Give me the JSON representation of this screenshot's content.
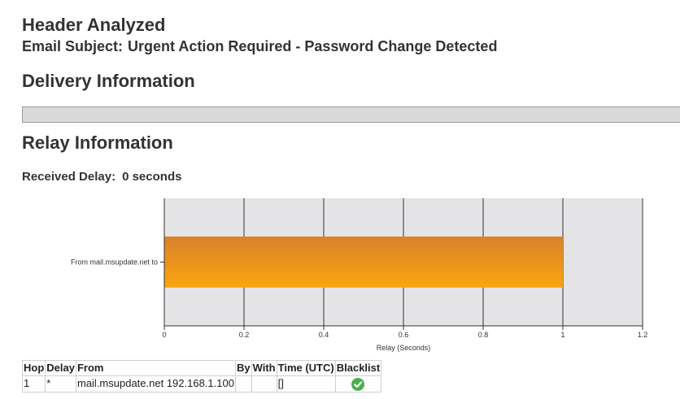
{
  "header": {
    "title": "Header Analyzed",
    "subject_label": "Email Subject:",
    "subject": "Urgent Action Required - Password Change Detected"
  },
  "delivery": {
    "heading": "Delivery Information"
  },
  "relay": {
    "heading": "Relay Information",
    "received_delay_label": "Received Delay:",
    "received_delay_value": "0 seconds"
  },
  "chart_data": {
    "type": "bar",
    "orientation": "horizontal",
    "categories": [
      "From mail.msupdate.net to"
    ],
    "values": [
      1
    ],
    "xlabel": "Relay (Seconds)",
    "ylabel": "",
    "xlim": [
      0,
      1.2
    ],
    "x_ticks": [
      "0",
      "0.2",
      "0.4",
      "0.6",
      "0.8",
      "1",
      "1.2"
    ],
    "grid": true,
    "colors": {
      "bar_top": "#d9822b",
      "bar_bottom": "#fba50f",
      "plot_bg": "#e4e4e6",
      "gridline": "#333333"
    }
  },
  "table": {
    "columns": [
      "Hop",
      "Delay",
      "From",
      "By",
      "With",
      "Time (UTC)",
      "Blacklist"
    ],
    "rows": [
      {
        "hop": "1",
        "delay": "*",
        "from": "mail.msupdate.net 192.168.1.100",
        "by": "",
        "with": "",
        "time": "[]",
        "blacklist_icon": "check-circle-icon",
        "blacklist_color": "#4caf50"
      }
    ]
  }
}
